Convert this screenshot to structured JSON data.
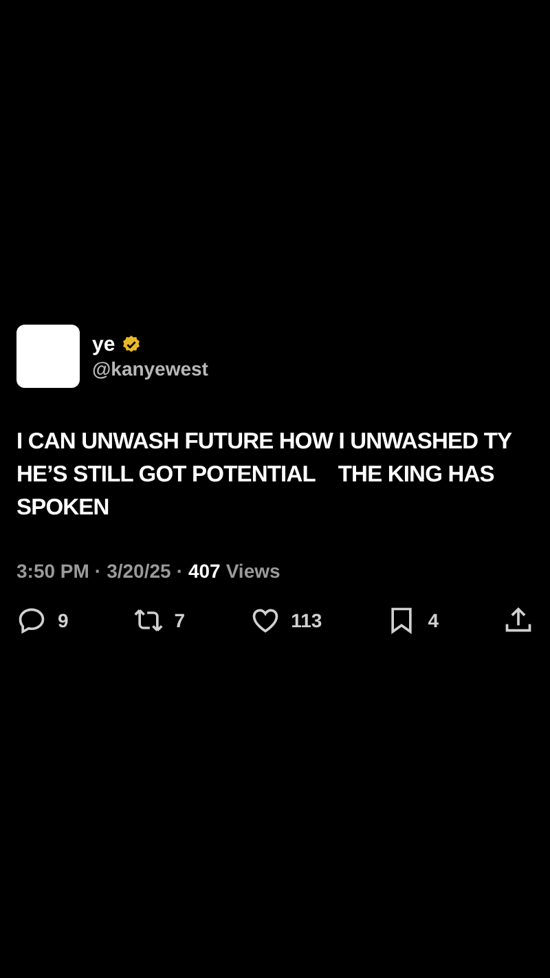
{
  "author": {
    "name": "ye",
    "handle": "@kanyewest",
    "verified": true
  },
  "text": "I CAN UNWASH FUTURE HOW I UNWASHED TY    HE’S STILL GOT POTENTIAL    THE KING HAS SPOKEN",
  "meta": {
    "time": "3:50 PM",
    "separator": "·",
    "date": "3/20/25",
    "views_count": "407",
    "views_label": "Views"
  },
  "actions": [
    {
      "kind": "reply",
      "count": "9"
    },
    {
      "kind": "repost",
      "count": "7"
    },
    {
      "kind": "like",
      "count": "113"
    },
    {
      "kind": "bookmark",
      "count": "4"
    },
    {
      "kind": "share"
    }
  ]
}
